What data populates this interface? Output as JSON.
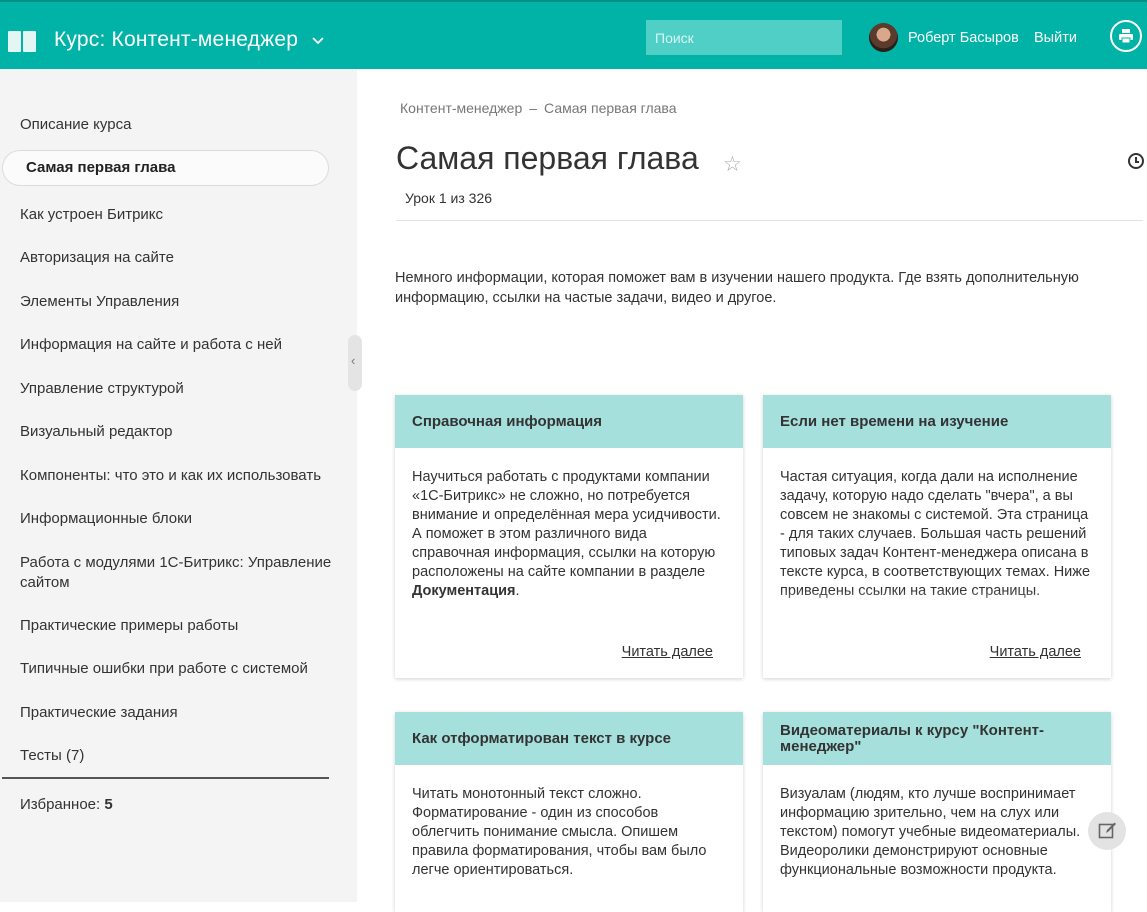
{
  "header": {
    "course_title": "Курс: Контент-менеджер",
    "search_placeholder": "Поиск",
    "user_name": "Роберт Басыров",
    "logout_label": "Выйти"
  },
  "sidebar": {
    "items": [
      {
        "label": "Описание курса"
      },
      {
        "label": "Самая первая глава",
        "active": true
      },
      {
        "label": "Как устроен Битрикс"
      },
      {
        "label": "Авторизация на сайте"
      },
      {
        "label": "Элементы Управления"
      },
      {
        "label": "Информация на сайте и работа с ней"
      },
      {
        "label": "Управление структурой"
      },
      {
        "label": "Визуальный редактор"
      },
      {
        "label": "Компоненты: что это и как их использовать"
      },
      {
        "label": "Информационные блоки"
      },
      {
        "label": "Работа с модулями 1С-Битрикс: Управление сайтом"
      },
      {
        "label": "Практические примеры работы"
      },
      {
        "label": "Типичные ошибки при работе с системой"
      },
      {
        "label": "Практические задания"
      },
      {
        "label": "Тесты (7)"
      }
    ],
    "favorites_label": "Избранное:",
    "favorites_count": "5",
    "collapse_glyph": "‹"
  },
  "main": {
    "breadcrumb": [
      "Контент-менеджер",
      "Самая первая глава"
    ],
    "breadcrumb_sep": "–",
    "title": "Самая первая глава",
    "star_glyph": "☆",
    "lesson_counter": "Урок 1 из 326",
    "intro": "Немного информации, которая поможет вам в изучении нашего продукта. Где взять дополнительную информацию, ссылки на частые задачи, видео и другое."
  },
  "cards": [
    {
      "title": "Справочная информация",
      "text_before": "Научиться работать с продуктами компании «1С-Битрикс» не сложно, но потребуется внимание и определённая мера усидчивости. А поможет в этом различного вида справочная информация, ссылки на которую расположены на сайте компании в разделе ",
      "text_bold": "Документация",
      "text_after": ".",
      "more": "Читать далее"
    },
    {
      "title": "Если нет времени на изучение",
      "text_before": "Частая ситуация, когда дали на исполнение задачу, которую надо сделать \"вчера\", а вы совсем не знакомы с системой. Эта страница - для таких случаев. Большая часть решений типовых задач Контент-менеджера описана в тексте курса, в соответствующих темах. Ниже приведены ссылки на такие страницы.",
      "text_bold": "",
      "text_after": "",
      "more": "Читать далее"
    },
    {
      "title": "Как отформатирован текст в курсе",
      "text_before": "Читать монотонный текст сложно. Форматирование - один из способов облегчить понимание смысла. Опишем правила форматирования, чтобы вам было легче ориентироваться.",
      "text_bold": "",
      "text_after": "",
      "more": ""
    },
    {
      "title": "Видеоматериалы к курсу \"Контент-менеджер\"",
      "text_before": "Визуалам (людям, кто лучше воспринимает информацию зрительно, чем на слух или текстом) помогут учебные видеоматериалы. Видеоролики демонстрируют основные функциональные возможности продукта.",
      "text_bold": "",
      "text_after": "",
      "more": ""
    }
  ],
  "icons": {
    "logo": "book-icon",
    "chevron": "chevron-down-icon",
    "print": "printer-icon",
    "history": "clock-icon",
    "edit": "edit-icon"
  },
  "colors": {
    "topbar": "#00b3a6",
    "card_header": "#a6e0dc",
    "sidebar_bg": "#f4f4f4"
  }
}
